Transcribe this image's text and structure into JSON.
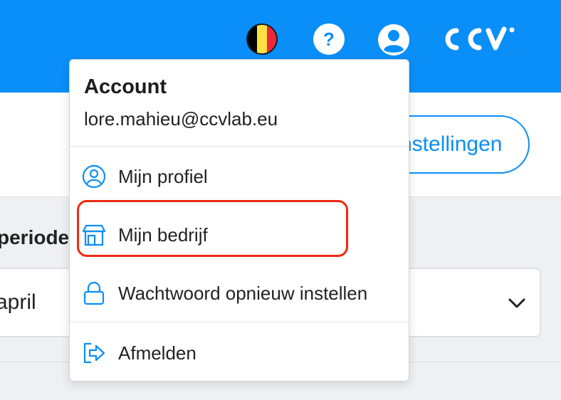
{
  "header": {
    "flag": "belgium-flag",
    "help_glyph": "?",
    "brand": "CCV",
    "colors": {
      "primary": "#0a8ef8",
      "highlight": "#ee2a12"
    }
  },
  "page": {
    "settings_button": "nstellingen",
    "period_label": "periode",
    "period_value": "april"
  },
  "account_menu": {
    "title": "Account",
    "email": "lore.mahieu@ccvlab.eu",
    "items": [
      {
        "label": "Mijn profiel",
        "icon": "user-circle-icon"
      },
      {
        "label": "Mijn bedrijf",
        "icon": "store-icon"
      },
      {
        "label": "Wachtwoord opnieuw instellen",
        "icon": "lock-icon"
      },
      {
        "label": "Afmelden",
        "icon": "logout-icon"
      }
    ]
  }
}
